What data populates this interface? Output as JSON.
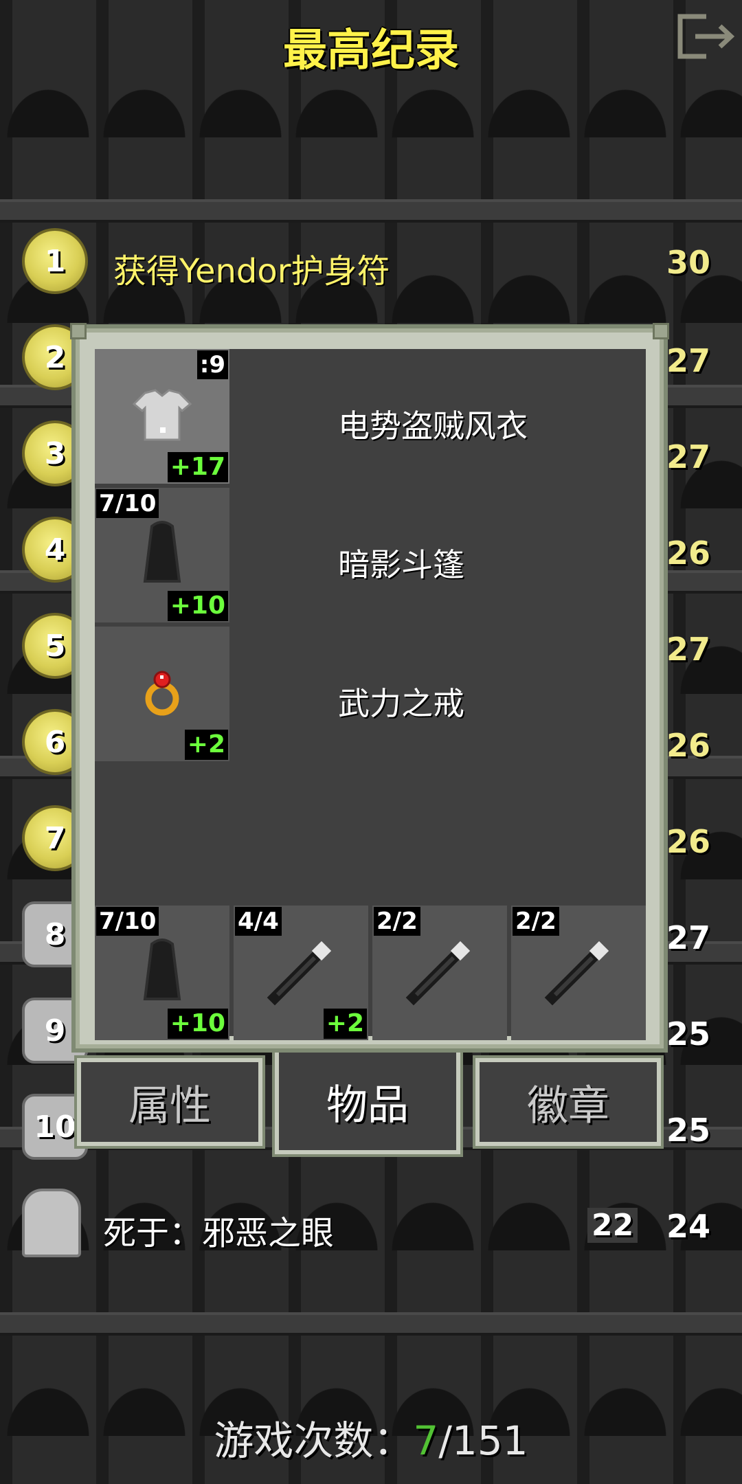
{
  "title": "最高纪录",
  "rankings": [
    {
      "rank": "1",
      "text": "获得Yendor护身符",
      "level": "30"
    },
    {
      "rank": "2",
      "level": "27"
    },
    {
      "rank": "3",
      "level": "27"
    },
    {
      "rank": "4",
      "level": "26"
    },
    {
      "rank": "5",
      "level": "27"
    },
    {
      "rank": "6",
      "level": "26"
    },
    {
      "rank": "7",
      "level": "26"
    },
    {
      "rank": "8",
      "level": "27"
    },
    {
      "rank": "9",
      "level": "25"
    },
    {
      "rank": "10",
      "level": "25"
    }
  ],
  "death": {
    "text": "死于：邪恶之眼",
    "depth": "22",
    "level": "24"
  },
  "games": {
    "label": "游戏次数：",
    "current": "7",
    "total": "/151"
  },
  "popup": {
    "items": [
      {
        "name": "电势盗贼风衣",
        "top_right": ":9",
        "bonus": "+17"
      },
      {
        "name": "暗影斗篷",
        "top_left": "7/10",
        "bonus": "+10"
      },
      {
        "name": "武力之戒",
        "bonus": "+2"
      }
    ],
    "quickslots": [
      {
        "top_left": "7/10",
        "bonus": "+10",
        "icon": "cloak-icon"
      },
      {
        "top_left": "4/4",
        "bonus": "+2",
        "icon": "wand-icon"
      },
      {
        "top_left": "2/2",
        "icon": "wand-icon"
      },
      {
        "top_left": "2/2",
        "icon": "wand-icon"
      }
    ],
    "tabs": {
      "stats": "属性",
      "items": "物品",
      "badges": "徽章"
    }
  },
  "colors": {
    "title": "#fff24a",
    "bonus": "#6cff3c",
    "games_current": "#52c234"
  }
}
